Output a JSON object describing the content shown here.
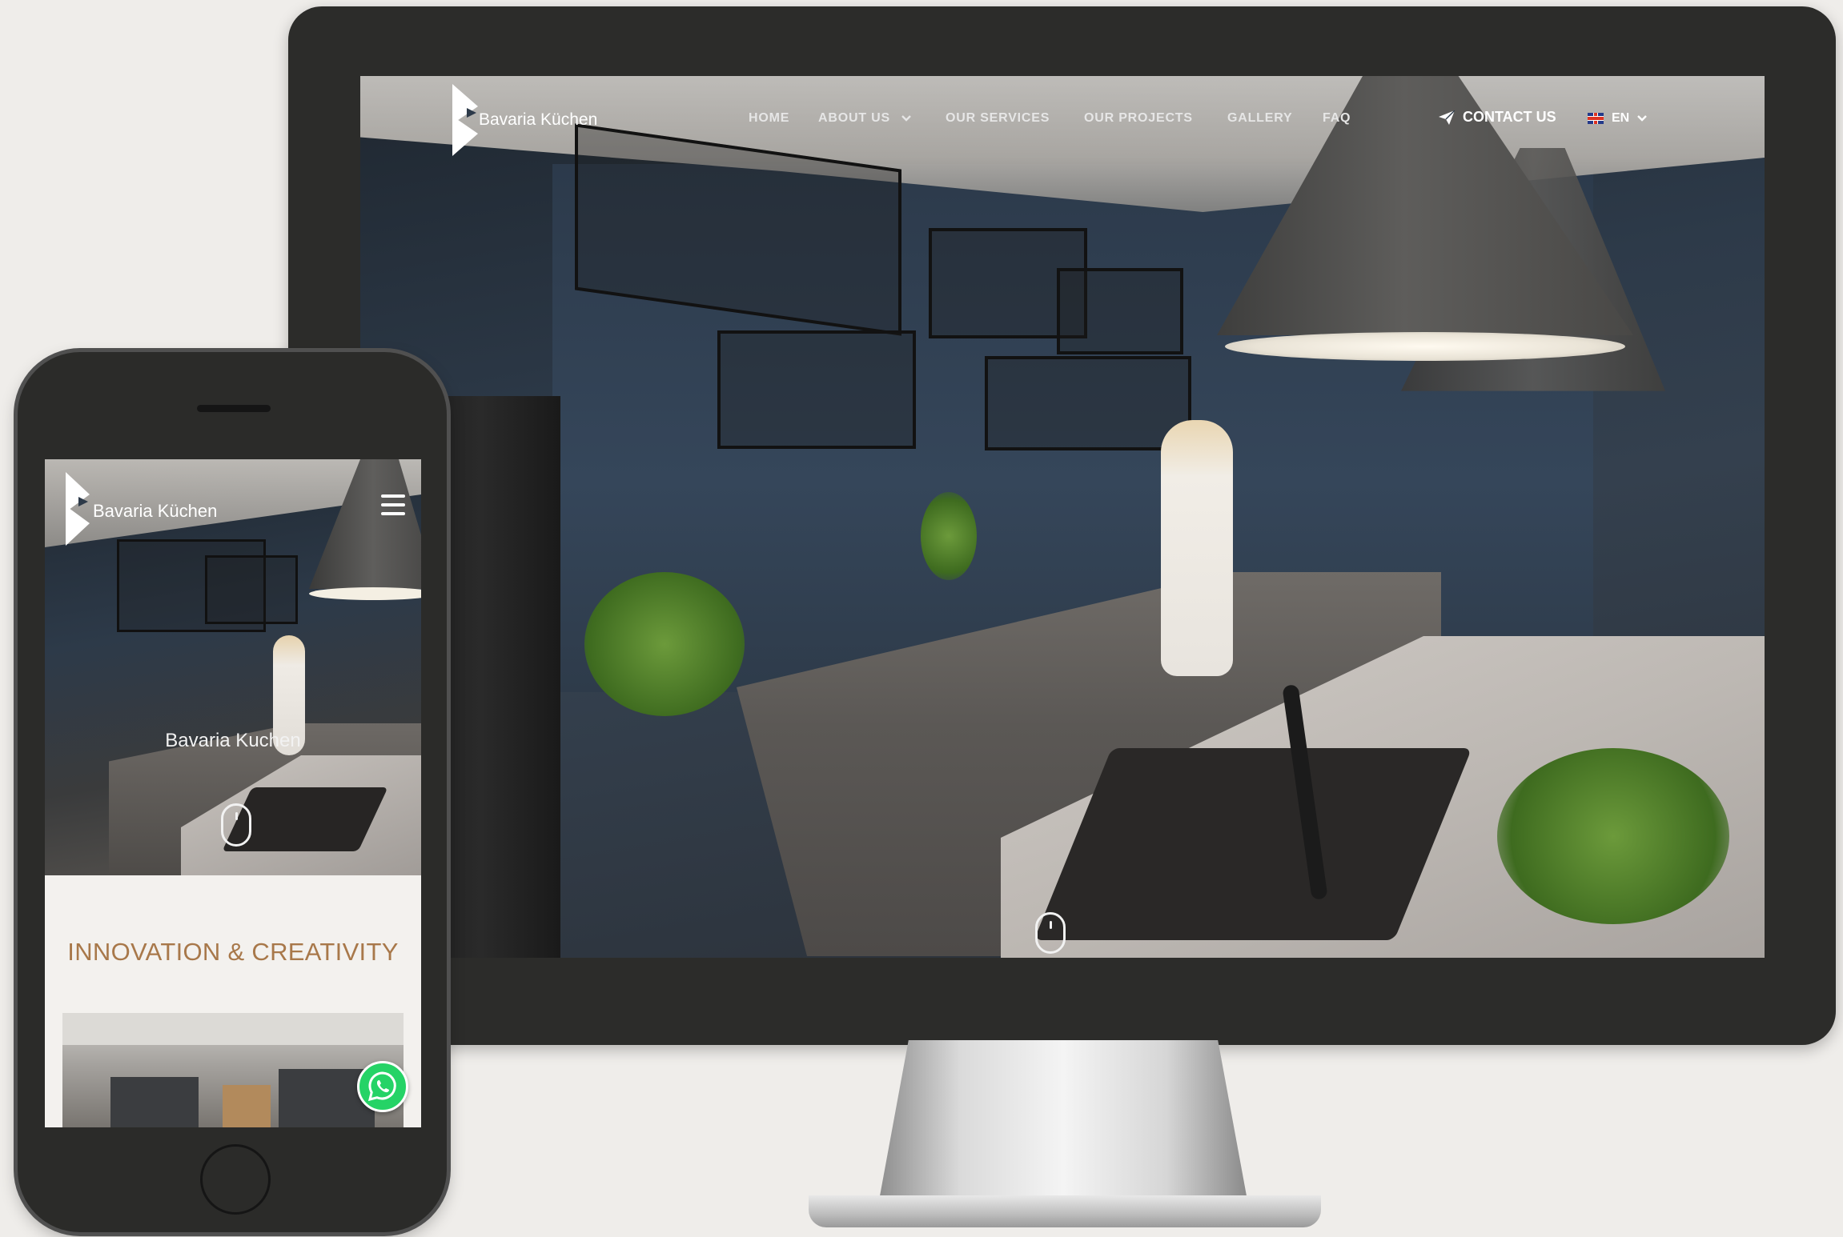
{
  "desktop": {
    "brand": "Bavaria Küchen",
    "nav": {
      "home": "HOME",
      "about": "ABOUT US",
      "services": "OUR SERVICES",
      "projects": "OUR PROJECTS",
      "gallery": "GALLERY",
      "faq": "FAQ"
    },
    "contact_label": "CONTACT US",
    "language": "EN",
    "icons": [
      "logo-mark-icon",
      "chevron-down-icon",
      "paper-plane-icon",
      "uk-flag-icon",
      "scroll-mouse-icon"
    ]
  },
  "mobile": {
    "brand": "Bavaria Küchen",
    "hero_title": "Bavaria Kuchen",
    "tagline": "INNOVATION & CREATIVITY",
    "icons": [
      "hamburger-menu-icon",
      "scroll-mouse-icon",
      "whatsapp-icon"
    ]
  },
  "colors": {
    "device_frame": "#2c2c2a",
    "background": "#efedea",
    "tagline": "#a8784a",
    "whatsapp": "#25d366"
  }
}
